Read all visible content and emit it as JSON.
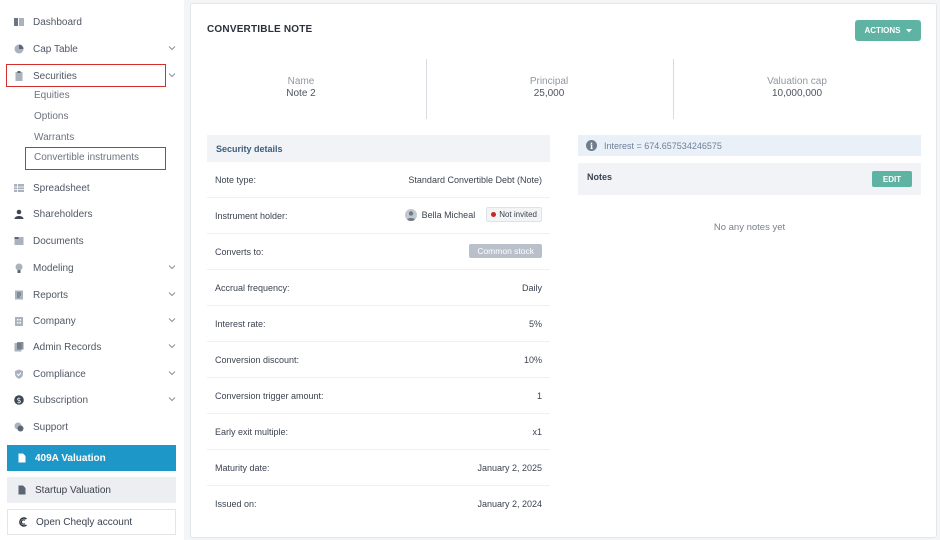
{
  "sidebar": {
    "items": [
      {
        "label": "Dashboard",
        "icon": "dashboard-icon"
      },
      {
        "label": "Cap Table",
        "icon": "pie-chart-icon"
      },
      {
        "label": "Securities",
        "icon": "clipboard-icon"
      },
      {
        "label": "Spreadsheet",
        "icon": "spreadsheet-icon"
      },
      {
        "label": "Shareholders",
        "icon": "person-icon"
      },
      {
        "label": "Documents",
        "icon": "document-icon"
      },
      {
        "label": "Modeling",
        "icon": "lightbulb-icon"
      },
      {
        "label": "Reports",
        "icon": "reports-icon"
      },
      {
        "label": "Company",
        "icon": "company-icon"
      },
      {
        "label": "Admin Records",
        "icon": "admin-records-icon"
      },
      {
        "label": "Compliance",
        "icon": "shield-check-icon"
      },
      {
        "label": "Subscription",
        "icon": "dollar-icon"
      },
      {
        "label": "Support",
        "icon": "support-icon"
      }
    ],
    "securities_sub": [
      "Equities",
      "Options",
      "Warrants",
      "Convertible instruments"
    ],
    "btn_409a": "409A Valuation",
    "btn_startup": "Startup Valuation",
    "btn_open": "Open Cheqly account",
    "highlight_color": "#d32f2f",
    "accent_color": "#1c97c7"
  },
  "main": {
    "title": "CONVERTIBLE NOTE",
    "actions_label": "ACTIONS",
    "stats": [
      {
        "label": "Name",
        "value": "Note 2"
      },
      {
        "label": "Principal",
        "value": "25,000"
      },
      {
        "label": "Valuation cap",
        "value": "10,000,000"
      }
    ],
    "details_title": "Security details",
    "details": {
      "note_type": {
        "label": "Note type:",
        "value": "Standard Convertible Debt (Note)"
      },
      "holder": {
        "label": "Instrument holder:",
        "name": "Bella Micheal",
        "status": "Not invited"
      },
      "converts_to": {
        "label": "Converts to:",
        "value": "Common stock"
      },
      "accrual": {
        "label": "Accrual frequency:",
        "value": "Daily"
      },
      "interest_rate": {
        "label": "Interest rate:",
        "value": "5%"
      },
      "conv_discount": {
        "label": "Conversion discount:",
        "value": "10%"
      },
      "conv_trigger": {
        "label": "Conversion trigger amount:",
        "value": "1"
      },
      "early_exit": {
        "label": "Early exit multiple:",
        "value": "x1"
      },
      "maturity": {
        "label": "Maturity date:",
        "value": "January 2, 2025"
      },
      "issued": {
        "label": "Issued on:",
        "value": "January 2, 2024"
      }
    },
    "interest_text": "Interest = 674.657534246575",
    "notes_label": "Notes",
    "edit_label": "EDIT",
    "no_notes": "No any notes yet",
    "button_color": "#5fb3a3"
  }
}
